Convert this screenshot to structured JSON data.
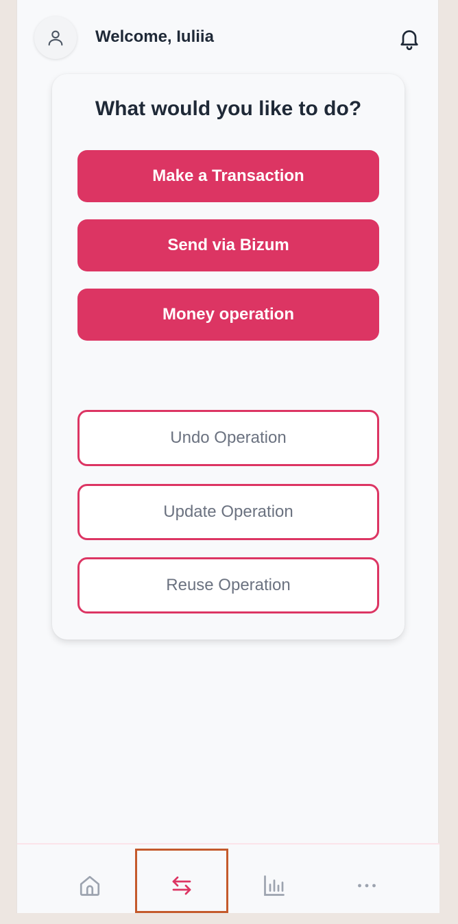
{
  "header": {
    "welcome_text": "Welcome, Iuliia",
    "avatar_icon": "user-icon",
    "notification_icon": "bell-icon"
  },
  "card": {
    "title": "What would you like to do?",
    "primary_actions": [
      {
        "label": "Make a Transaction"
      },
      {
        "label": "Send via Bizum"
      },
      {
        "label": "Money operation"
      }
    ],
    "secondary_actions": [
      {
        "label": "Undo Operation"
      },
      {
        "label": "Update Operation"
      },
      {
        "label": "Reuse Operation"
      }
    ]
  },
  "bottom_nav": {
    "items": [
      {
        "icon": "home-icon",
        "active": false
      },
      {
        "icon": "transfer-arrows-icon",
        "active": true
      },
      {
        "icon": "bar-chart-icon",
        "active": false
      },
      {
        "icon": "more-dots-icon",
        "active": false
      }
    ]
  },
  "colors": {
    "accent": "#dc3563",
    "text_dark": "#1f2937",
    "text_muted": "#6b7280",
    "nav_inactive": "#9ca3af",
    "highlight_box": "#c45a2c"
  }
}
